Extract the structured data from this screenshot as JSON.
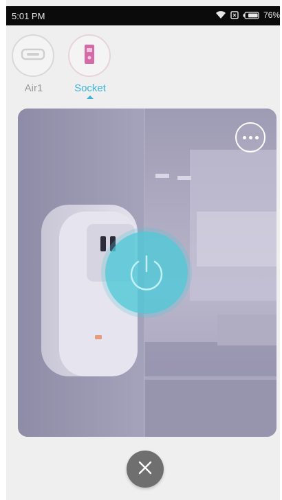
{
  "status_bar": {
    "time": "5:01 PM",
    "battery_percent": "76%",
    "icons": [
      "wifi-icon",
      "sim-icon",
      "battery-icon"
    ]
  },
  "device_tabs": [
    {
      "label": "Air1",
      "icon": "air-purifier-icon",
      "active": false
    },
    {
      "label": "Socket",
      "icon": "smart-plug-icon",
      "active": true
    }
  ],
  "device_card": {
    "more_icon": "more-options-icon",
    "power_icon": "power-icon",
    "power_state": "on"
  },
  "close_icon": "close-icon",
  "colors": {
    "accent": "#3db4d6",
    "power_button": "#50c8d7",
    "socket_icon": "#d46aa6",
    "close_button": "#6f6f6f"
  }
}
